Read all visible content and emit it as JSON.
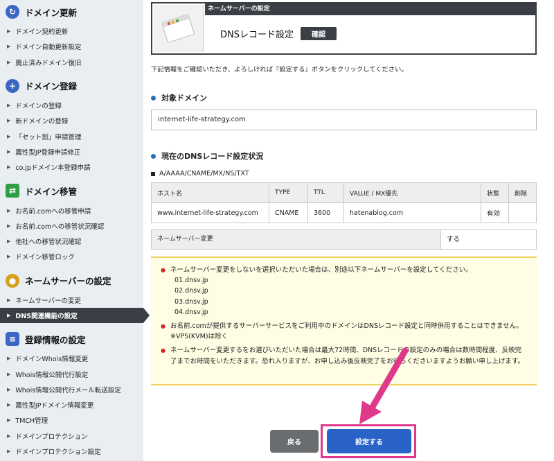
{
  "sidebar": {
    "sections": [
      {
        "title": "ドメイン更新",
        "icon": "refresh-icon",
        "color": "#3a66c4",
        "items": [
          "ドメイン契約更新",
          "ドメイン自動更新設定",
          "廃止済みドメイン復旧"
        ]
      },
      {
        "title": "ドメイン登録",
        "icon": "plus-icon",
        "color": "#3a66c4",
        "items": [
          "ドメインの登録",
          "新ドメインの登録",
          "「セット割」申請管理",
          "属性型JP登録申請修正",
          "co.jpドメイン本登録申請"
        ]
      },
      {
        "title": "ドメイン移管",
        "icon": "transfer-icon",
        "color": "#2f9e44",
        "items": [
          "お名前.comへの移管申請",
          "お名前.comへの移管状況確認",
          "他社への移管状況確認",
          "ドメイン移管ロック"
        ]
      },
      {
        "title": "ネームサーバーの設定",
        "icon": "nameserver-icon",
        "color": "#d4a017",
        "items": [
          "ネームサーバーの変更",
          "DNS関連機能の設定"
        ]
      },
      {
        "title": "登録情報の設定",
        "icon": "database-icon",
        "color": "#3a66c4",
        "items": [
          "ドメインWhois情報変更",
          "Whois情報公開代行設定",
          "Whois情報公開代行メール転送設定",
          "属性型JPドメイン情報変更",
          "TMCH管理",
          "ドメインプロテクション",
          "ドメインプロテクション設定"
        ]
      }
    ],
    "active_item": "DNS関連機能の設定"
  },
  "header": {
    "tab_label": "ネームサーバーの設定",
    "title": "DNSレコード設定",
    "badge": "確認"
  },
  "intro": "下記情報をご確認いただき、よろしければ『設定する』ボタンをクリックしてください。",
  "target_domain": {
    "heading": "対象ドメイン",
    "value": "internet-life-strategy.com"
  },
  "dns_status": {
    "heading": "現在のDNSレコード設定状況",
    "record_types": "A/AAAA/CNAME/MX/NS/TXT",
    "columns": [
      "ホスト名",
      "TYPE",
      "TTL",
      "VALUE / MX優先",
      "状態",
      "削除"
    ],
    "rows": [
      [
        "www.internet-life-strategy.com",
        "CNAME",
        "3600",
        "hatenablog.com",
        "有効",
        ""
      ]
    ]
  },
  "nameserver_change": {
    "label": "ネームサーバー変更",
    "value": "する"
  },
  "notices": {
    "n1": "ネームサーバー変更をしないを選択いただいた場合は、別途以下ネームサーバーを設定してください。",
    "servers": [
      "01.dnsv.jp",
      "02.dnsv.jp",
      "03.dnsv.jp",
      "04.dnsv.jp"
    ],
    "n2": "お名前.comが提供するサーバーサービスをご利用中のドメインはDNSレコード設定と同時併用することはできません。",
    "n2b": "※VPS(KVM)は除く",
    "n3": "ネームサーバー変更するをお選びいただいた場合は最大72時間、DNSレコードの設定のみの場合は数時間程度、反映完了までお時間をいただきます。恐れ入りますが、お申し込み後反映完了をお待ちくださいますようお願い申し上げます。"
  },
  "buttons": {
    "back": "戻る",
    "submit": "設定する"
  },
  "colors": {
    "accent": "#2a63c8",
    "highlight": "#e0388a",
    "dark": "#3b3f45",
    "notice_bg": "#fffde3"
  }
}
